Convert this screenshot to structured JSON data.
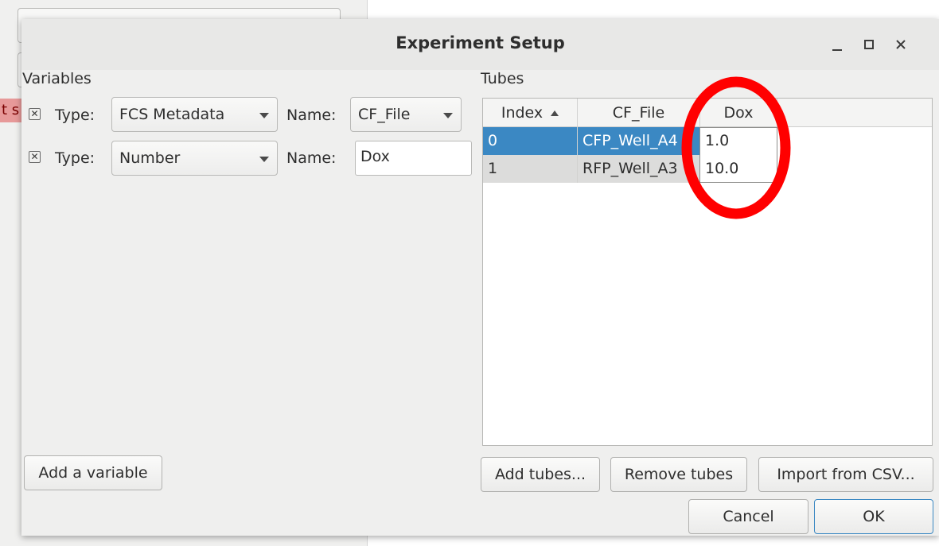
{
  "background": {
    "red_label_text": "t s"
  },
  "dialog": {
    "title": "Experiment Setup",
    "minimize_icon": "minimize-icon",
    "maximize_icon": "maximize-icon",
    "close_icon": "close-icon"
  },
  "variables": {
    "section_label": "Variables",
    "rows": [
      {
        "type_label": "Type:",
        "type_value": "FCS Metadata",
        "name_label": "Name:",
        "name_value": "CF_File",
        "name_kind": "dropdown"
      },
      {
        "type_label": "Type:",
        "type_value": "Number",
        "name_label": "Name:",
        "name_value": "Dox",
        "name_kind": "entry"
      }
    ],
    "add_button": "Add a variable"
  },
  "tubes": {
    "section_label": "Tubes",
    "columns": [
      "Index",
      "CF_File",
      "Dox"
    ],
    "sorted_column": "Index",
    "rows": [
      {
        "index": "0",
        "cf_file": "CFP_Well_A4",
        "dox": "1.0",
        "selected": true
      },
      {
        "index": "1",
        "cf_file": "RFP_Well_A3",
        "dox": "10.0",
        "selected": false
      }
    ],
    "add_button": "Add tubes...",
    "remove_button": "Remove tubes",
    "import_button": "Import from CSV..."
  },
  "footer": {
    "cancel": "Cancel",
    "ok": "OK"
  },
  "colors": {
    "selection": "#3b88c3",
    "annotation": "#ff0000"
  }
}
